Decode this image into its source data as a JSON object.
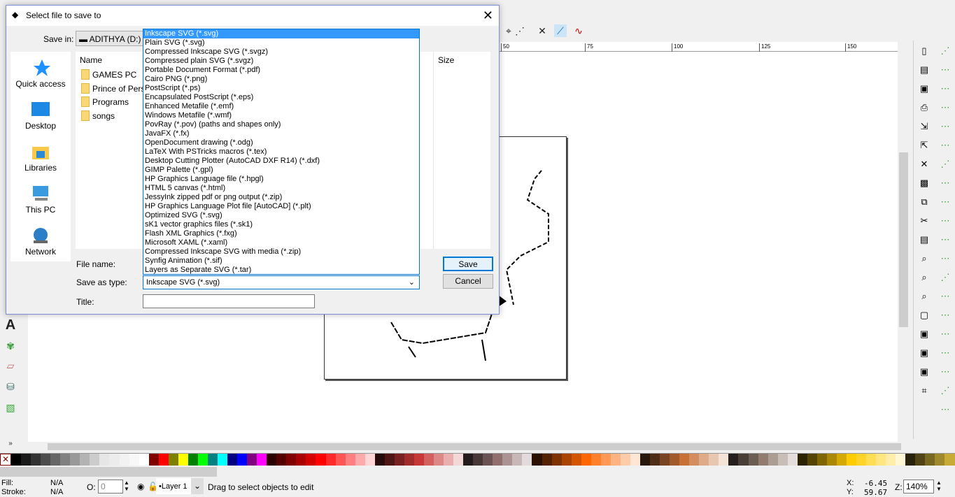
{
  "dialog": {
    "title": "Select file to save to",
    "save_in_label": "Save in:",
    "save_in_value": "ADITHYA (D:)",
    "places": [
      {
        "label": "Quick access",
        "icon": "star-icon"
      },
      {
        "label": "Desktop",
        "icon": "desktop-icon"
      },
      {
        "label": "Libraries",
        "icon": "libraries-icon"
      },
      {
        "label": "This PC",
        "icon": "computer-icon"
      },
      {
        "label": "Network",
        "icon": "network-icon"
      }
    ],
    "columns": {
      "name": "Name",
      "size": "Size"
    },
    "files": [
      "GAMES PC",
      "Prince of Persia",
      "Programs",
      "songs"
    ],
    "file_name_label": "File name:",
    "file_name_value": "",
    "save_as_type_label": "Save as type:",
    "save_as_type_value": "Inkscape SVG (*.svg)",
    "title_label": "Title:",
    "title_value": "",
    "save_button": "Save",
    "cancel_button": "Cancel",
    "type_options": [
      "Inkscape SVG (*.svg)",
      "Plain SVG (*.svg)",
      "Compressed Inkscape SVG (*.svgz)",
      "Compressed plain SVG (*.svgz)",
      "Portable Document Format (*.pdf)",
      "Cairo PNG (*.png)",
      "PostScript (*.ps)",
      "Encapsulated PostScript (*.eps)",
      "Enhanced Metafile (*.emf)",
      "Windows Metafile (*.wmf)",
      "PovRay (*.pov) (paths and shapes only)",
      "JavaFX (*.fx)",
      "OpenDocument drawing (*.odg)",
      "LaTeX With PSTricks macros (*.tex)",
      "Desktop Cutting Plotter (AutoCAD DXF R14) (*.dxf)",
      "GIMP Palette (*.gpl)",
      "HP Graphics Language file (*.hpgl)",
      "HTML 5 canvas (*.html)",
      "JessyInk zipped pdf or png output (*.zip)",
      "HP Graphics Language Plot file [AutoCAD] (*.plt)",
      "Optimized SVG (*.svg)",
      "sK1 vector graphics files (*.sk1)",
      "Flash XML Graphics (*.fxg)",
      "Microsoft XAML (*.xaml)",
      "Compressed Inkscape SVG with media (*.zip)",
      "Synfig Animation (*.sif)",
      "Layers as Separate SVG (*.tar)"
    ]
  },
  "ruler": [
    "50",
    "75",
    "100",
    "125",
    "150"
  ],
  "status": {
    "fill_label": "Fill:",
    "fill_value": "N/A",
    "stroke_label": "Stroke:",
    "stroke_value": "N/A",
    "opacity_label": "O:",
    "opacity_value": "0",
    "layer": "•Layer 1",
    "message": "Drag to select objects to edit",
    "x_label": "X:",
    "x_value": "-6.45",
    "y_label": "Y:",
    "y_value": "59.67",
    "zoom_label": "Z:",
    "zoom_value": "140%"
  },
  "palette": [
    "#000000",
    "#1a1a1a",
    "#333333",
    "#4d4d4d",
    "#666666",
    "#808080",
    "#999999",
    "#b3b3b3",
    "#cccccc",
    "#e6e6e6",
    "#ececec",
    "#f2f2f2",
    "#f8f8f8",
    "#ffffff",
    "#800000",
    "#ff0000",
    "#808000",
    "#ffff00",
    "#008000",
    "#00ff00",
    "#008080",
    "#00ffff",
    "#000080",
    "#0000ff",
    "#800080",
    "#ff00ff",
    "#2b0000",
    "#550000",
    "#800000",
    "#aa0000",
    "#d40000",
    "#ff0000",
    "#ff2a2a",
    "#ff5555",
    "#ff8080",
    "#ffaaaa",
    "#ffd5d5",
    "#280b0b",
    "#501616",
    "#782121",
    "#a02c2c",
    "#c83737",
    "#d35f5f",
    "#de8787",
    "#e9afaf",
    "#f4d7d7",
    "#241c1c",
    "#483737",
    "#6c5353",
    "#916f6f",
    "#ac9393",
    "#c8b7b7",
    "#e3dbdb",
    "#2b1100",
    "#552200",
    "#803300",
    "#aa4400",
    "#d45500",
    "#ff6600",
    "#ff7f2a",
    "#ff9955",
    "#ffb380",
    "#ffccaa",
    "#ffe6d5",
    "#28170b",
    "#502d16",
    "#784421",
    "#a05a2c",
    "#c87137",
    "#d38d5f",
    "#deaa87",
    "#e9c6af",
    "#f4e3d7",
    "#241f1c",
    "#483e37",
    "#6c5d53",
    "#917c6f",
    "#ac9d93",
    "#c8beb7",
    "#e3dedb",
    "#2b2200",
    "#554400",
    "#806600",
    "#aa8800",
    "#d4aa00",
    "#ffcc00",
    "#ffd42a",
    "#ffdd55",
    "#ffe680",
    "#ffeeaa",
    "#fff6d5",
    "#28220b",
    "#504416",
    "#786721",
    "#a0892c",
    "#c8ab37"
  ]
}
